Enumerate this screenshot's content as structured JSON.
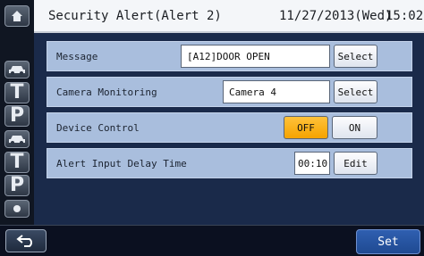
{
  "header": {
    "title": "Security Alert(Alert 2)",
    "date": "11/27/2013(Wed)",
    "time": "15:02"
  },
  "rail": {
    "icons": [
      "home-icon",
      "car-icon",
      "car-icon",
      "parking-icon"
    ],
    "letters": [
      "T",
      "P",
      "T",
      "P"
    ]
  },
  "settings": {
    "message": {
      "label": "Message",
      "value": "[A12]DOOR OPEN",
      "button": "Select"
    },
    "camera": {
      "label": "Camera Monitoring",
      "value": "Camera 4",
      "button": "Select"
    },
    "device": {
      "label": "Device Control",
      "off": "OFF",
      "on": "ON",
      "active": "OFF"
    },
    "delay": {
      "label": "Alert Input Delay Time",
      "value": "00:10",
      "button": "Edit"
    }
  },
  "footer": {
    "set_label": "Set"
  },
  "colors": {
    "active_toggle": "#f5a300",
    "content_bg": "#1a2a4a",
    "row_bg": "#a9bedd"
  }
}
